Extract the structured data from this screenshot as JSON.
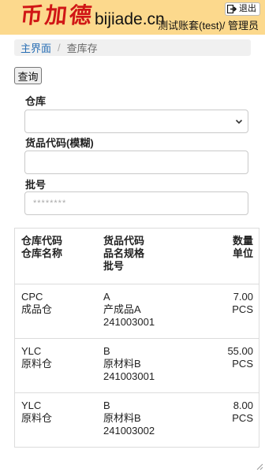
{
  "header": {
    "logo_text": "币加德",
    "domain": "bijiade.cn",
    "logout_label": "退出",
    "user_info": "测试账套(test)/ 管理员",
    "background_color": "#fcd98d",
    "logo_color": "#d01616"
  },
  "breadcrumb": {
    "home": "主界面",
    "separator": "/",
    "current": "查库存"
  },
  "toolbar": {
    "query_label": "查询"
  },
  "form": {
    "warehouse_label": "仓库",
    "warehouse_value": "",
    "code_label": "货品代码(模糊)",
    "code_value": "",
    "batch_label": "批号",
    "batch_placeholder": "********"
  },
  "table": {
    "headers": {
      "col1": [
        "仓库代码",
        "仓库名称"
      ],
      "col2": [
        "货品代码",
        "品名规格",
        "批号"
      ],
      "col3": [
        "数量",
        "单位"
      ]
    },
    "rows": [
      {
        "wh_code": "CPC",
        "wh_name": "成品仓",
        "item_code": "A",
        "item_name": "产成品A",
        "batch": "241003001",
        "qty": "7.00",
        "unit": "PCS"
      },
      {
        "wh_code": "YLC",
        "wh_name": "原料仓",
        "item_code": "B",
        "item_name": "原材料B",
        "batch": "241003001",
        "qty": "55.00",
        "unit": "PCS"
      },
      {
        "wh_code": "YLC",
        "wh_name": "原料仓",
        "item_code": "B",
        "item_name": "原材料B",
        "batch": "241003002",
        "qty": "8.00",
        "unit": "PCS"
      }
    ]
  },
  "icons": {
    "logout": "logout-icon",
    "dropdown": "chevron-down-icon",
    "resize": "resize-grip-icon"
  }
}
